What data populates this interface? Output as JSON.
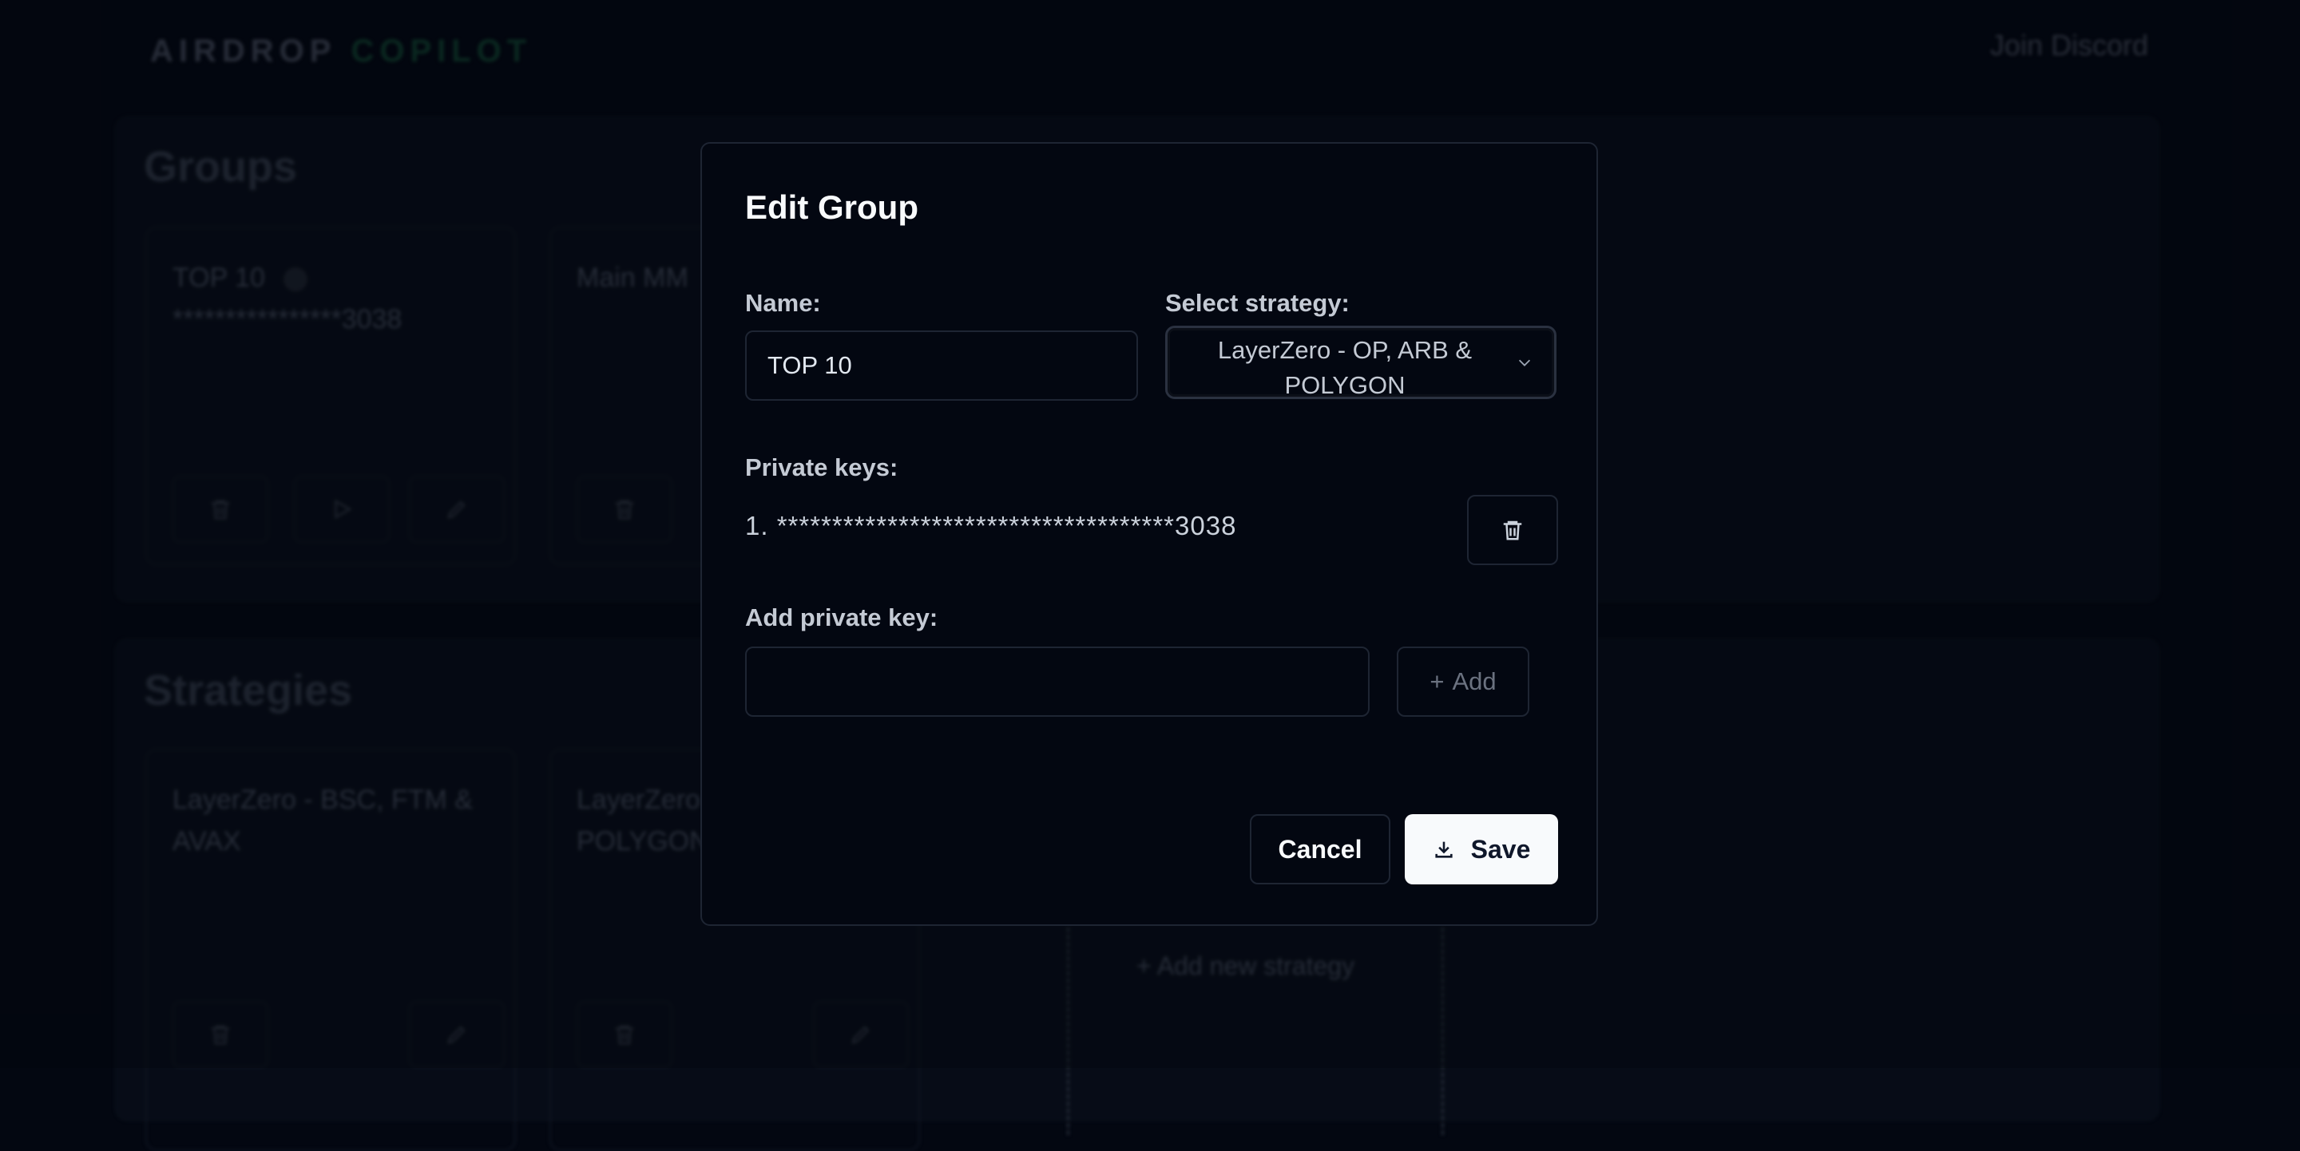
{
  "app": {
    "brand_part1": "AIRDROP",
    "brand_part2": "COPILOT",
    "nav_link": "Join Discord"
  },
  "groups_section": {
    "title": "Groups",
    "cards": [
      {
        "name": "TOP 10",
        "key": "****************3038"
      },
      {
        "name": "Main MM",
        "key": ""
      }
    ]
  },
  "strategies_section": {
    "title": "Strategies",
    "cards": [
      {
        "name": "LayerZero - BSC, FTM & AVAX"
      },
      {
        "name": "LayerZero - OP, ARB & POLYGON"
      }
    ],
    "add_new_label": "+ Add new strategy"
  },
  "modal": {
    "title": "Edit Group",
    "name_label": "Name:",
    "name_value": "TOP 10",
    "strategy_label": "Select strategy:",
    "strategy_value": "LayerZero - OP, ARB & POLYGON",
    "private_keys_label": "Private keys:",
    "private_keys": [
      "1. ************************************3038"
    ],
    "add_key_label": "Add private key:",
    "add_key_value": "",
    "add_button": "Add",
    "cancel_button": "Cancel",
    "save_button": "Save"
  },
  "colors": {
    "background": "#030711",
    "accent_green": "#0f3b2c",
    "save_bg": "#f8fafc",
    "border": "#1e2533"
  },
  "icons": [
    "trash-icon",
    "play-icon",
    "pencil-icon",
    "chevron-down-icon",
    "plus-icon",
    "download-icon"
  ]
}
